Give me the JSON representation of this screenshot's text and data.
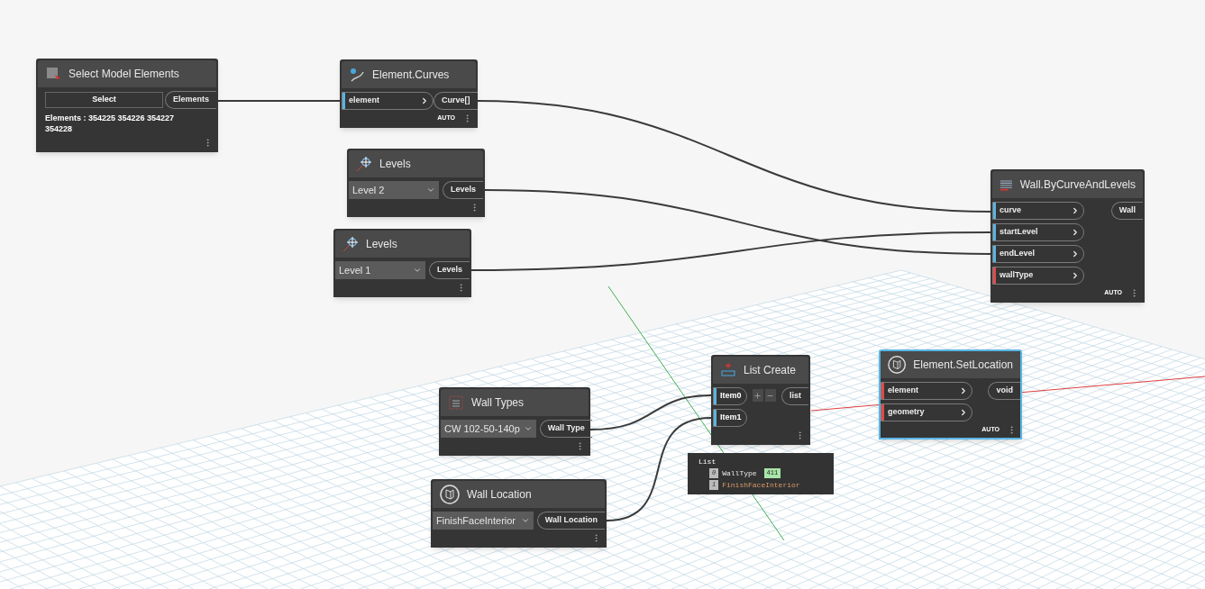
{
  "nodes": [
    {
      "kind": "selection",
      "title": "Select Model Elements",
      "selected": false,
      "button": "Select",
      "outputs": [
        "Elements"
      ],
      "result": "Elements : 354225 354226 354227 354228"
    },
    {
      "kind": "function",
      "title": "Element.Curves",
      "selected": false,
      "inputs": [
        {
          "label": "element",
          "color": "#5ab4e0"
        }
      ],
      "outputs": [
        "Curve[]"
      ],
      "footer": "AUTO"
    },
    {
      "kind": "dropdown",
      "title": "Levels",
      "selected": false,
      "value": "Level 2",
      "outputs": [
        "Levels"
      ]
    },
    {
      "kind": "dropdown",
      "title": "Levels",
      "selected": false,
      "value": "Level 1",
      "outputs": [
        "Levels"
      ]
    },
    {
      "kind": "function",
      "title": "Wall.ByCurveAndLevels",
      "selected": false,
      "inputs": [
        {
          "label": "curve",
          "color": "#5ab4e0"
        },
        {
          "label": "startLevel",
          "color": "#5ab4e0"
        },
        {
          "label": "endLevel",
          "color": "#5ab4e0"
        },
        {
          "label": "wallType",
          "color": "#e04b4b"
        }
      ],
      "outputs": [
        "Wall"
      ],
      "footer": "AUTO"
    },
    {
      "kind": "dropdown",
      "title": "Wall Types",
      "selected": false,
      "value": "CW 102-50-140p",
      "outputs": [
        "Wall Type"
      ]
    },
    {
      "kind": "dropdown",
      "title": "Wall Location",
      "selected": false,
      "value": "FinishFaceInterior",
      "outputs": [
        "Wall Location"
      ]
    },
    {
      "kind": "list_create",
      "title": "List Create",
      "selected": false,
      "inputs": [
        {
          "label": "Item0",
          "color": "#5ab4e0"
        },
        {
          "label": "Item1",
          "color": "#5ab4e0"
        }
      ],
      "outputs": [
        "list"
      ]
    },
    {
      "kind": "function",
      "title": "Element.SetLocation",
      "selected": true,
      "inputs": [
        {
          "label": "element",
          "color": "#e04b4b"
        },
        {
          "label": "geometry",
          "color": "#e04b4b"
        }
      ],
      "outputs": [
        "void"
      ],
      "footer": "AUTO"
    }
  ],
  "preview": {
    "title": "List",
    "items": [
      {
        "index": "0",
        "text": "WallType",
        "kind": "object",
        "badge": "411"
      },
      {
        "index": "1",
        "text": "FinishFaceInterior",
        "kind": "string"
      }
    ]
  }
}
